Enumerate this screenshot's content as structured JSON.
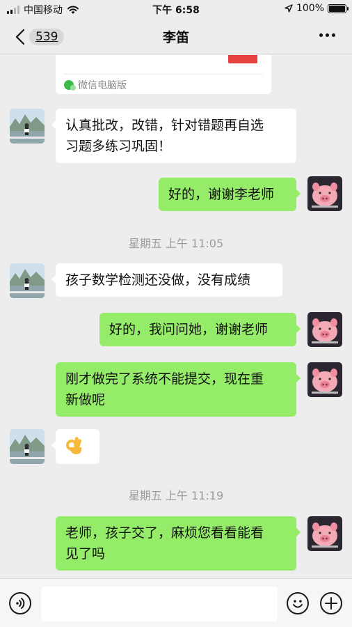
{
  "status_bar": {
    "carrier": "中国移动",
    "time": "下午 6:58",
    "battery_text": "100%",
    "battery_level": 1.0
  },
  "nav": {
    "back_count": "539",
    "title": "李笛"
  },
  "partial_card": {
    "source": "微信电脑版"
  },
  "messages": [
    {
      "from": "contact",
      "text_line1": "认真批改，改错，针对错题再自选",
      "text_line2": "习题多练习巩固！"
    },
    {
      "from": "me",
      "text": "好的，谢谢李老师"
    },
    {
      "type": "timestamp",
      "text": "星期五 上午 11:05"
    },
    {
      "from": "contact",
      "text": "孩子数学检测还没做，没有成绩"
    },
    {
      "from": "me",
      "text": "好的，我问问她，谢谢老师"
    },
    {
      "from": "me",
      "text_line1": "刚才做完了系统不能提交，现在重",
      "text_line2": "新做呢"
    },
    {
      "from": "contact",
      "text": "👌"
    },
    {
      "type": "timestamp",
      "text": "星期五 上午 11:19"
    },
    {
      "from": "me",
      "text_line1": "老师，孩子交了，麻烦您看看能看",
      "text_line2": "见了吗"
    }
  ],
  "colors": {
    "background": "#ededed",
    "bubble_out": "#95ec69",
    "bubble_in": "#ffffff",
    "timestamp": "#9b9b9b"
  },
  "icons": {
    "back": "chevron-left-icon",
    "more": "ellipsis-icon",
    "voice": "voice-icon",
    "emoji": "smiley-icon",
    "plus": "plus-icon"
  }
}
